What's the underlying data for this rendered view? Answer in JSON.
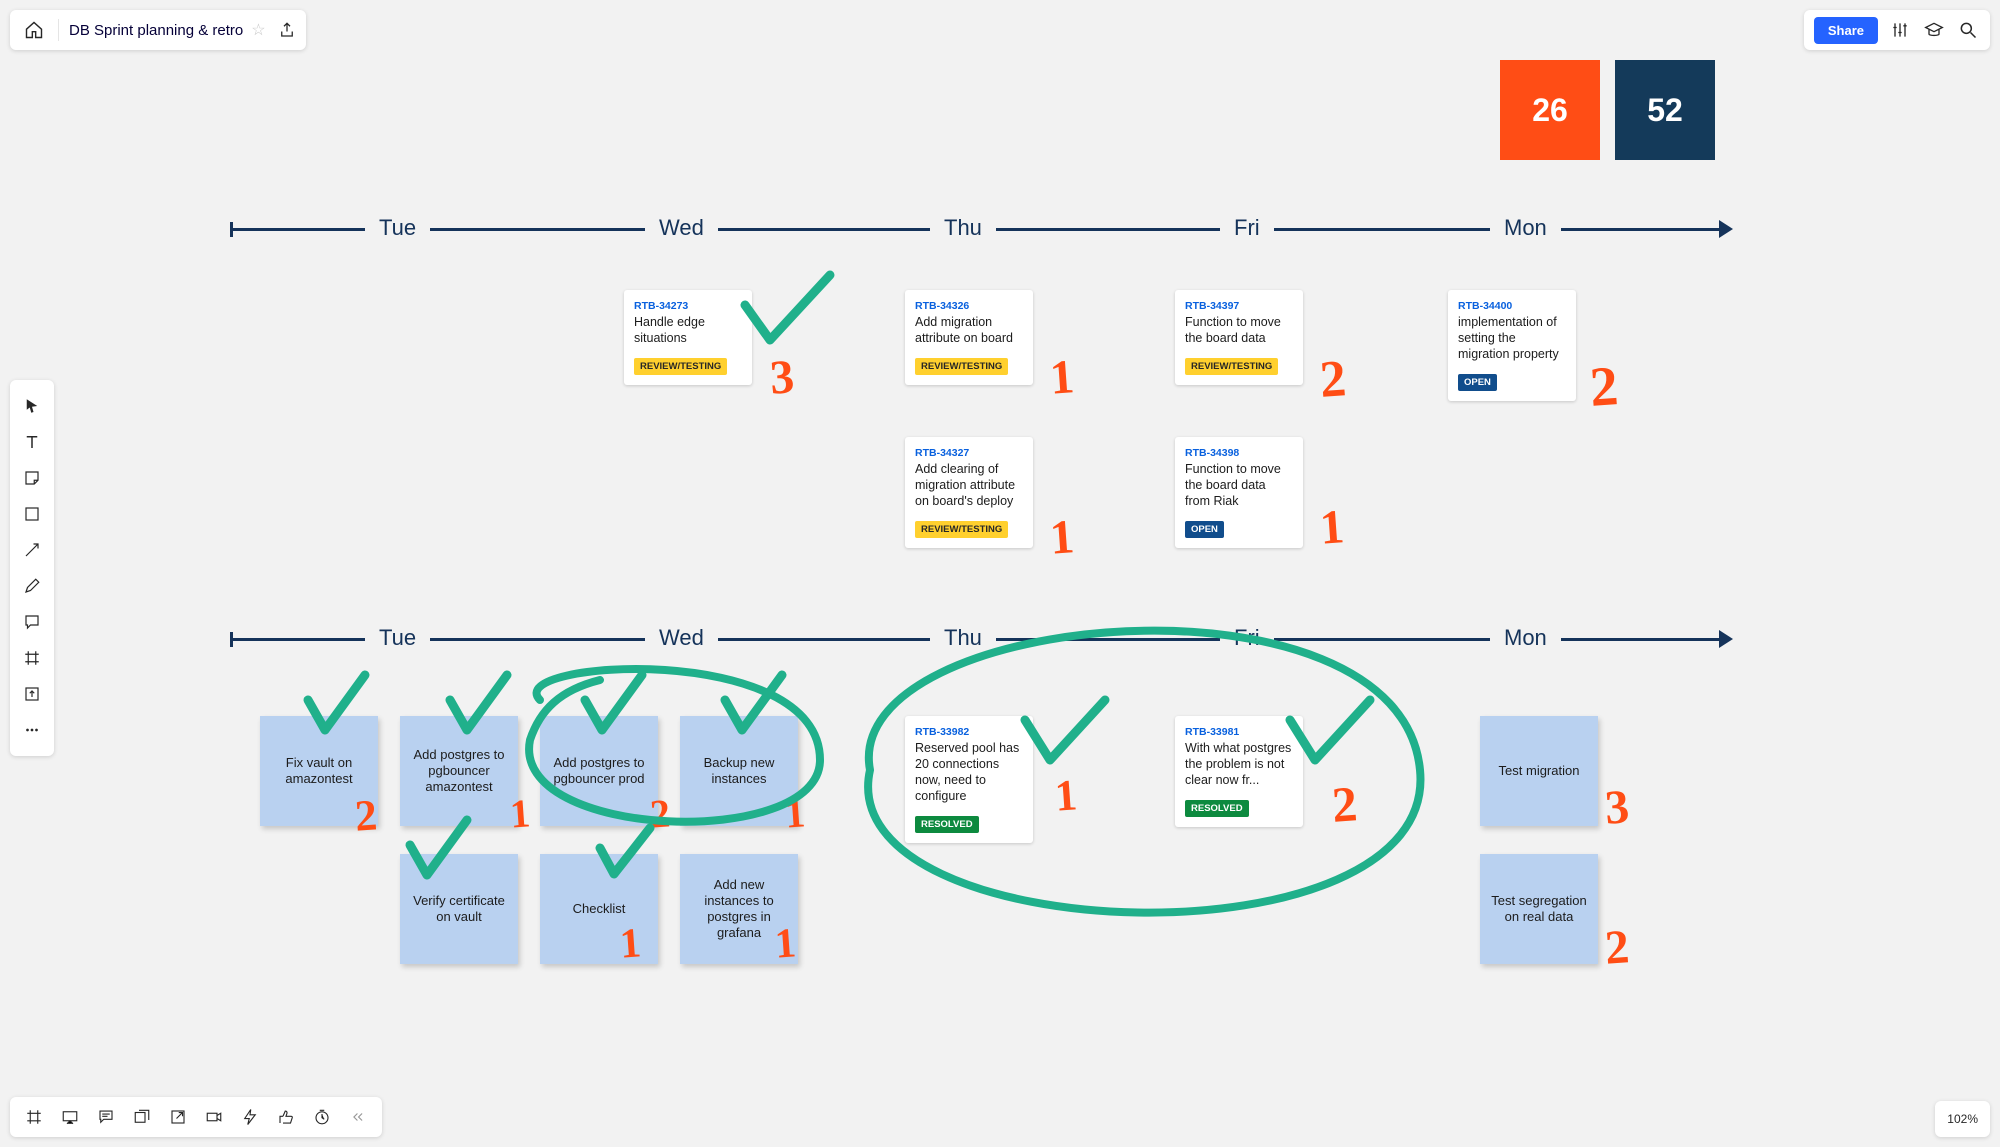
{
  "header": {
    "title": "DB Sprint planning & retro",
    "share_label": "Share"
  },
  "scores": {
    "orange": "26",
    "navy": "52"
  },
  "timeline_labels": [
    "Tue",
    "Wed",
    "Thu",
    "Fri",
    "Mon"
  ],
  "row1_cards": [
    {
      "id": "RTB-34273",
      "title": "Handle edge situations",
      "badge": "REVIEW/TESTING",
      "badge_cls": "b-review",
      "anno": "3",
      "check": true
    },
    {
      "id": "RTB-34326",
      "title": "Add migration attribute on board",
      "badge": "REVIEW/TESTING",
      "badge_cls": "b-review",
      "anno": "1"
    },
    {
      "id": "RTB-34397",
      "title": "Function to move the board data",
      "badge": "REVIEW/TESTING",
      "badge_cls": "b-review",
      "anno": "2"
    },
    {
      "id": "RTB-34400",
      "title": "implementation of setting the migration property",
      "badge": "OPEN",
      "badge_cls": "b-open",
      "anno": "2"
    },
    {
      "id": "RTB-34327",
      "title": "Add clearing of migration attribute on board's deploy",
      "badge": "REVIEW/TESTING",
      "badge_cls": "b-review",
      "anno": "1"
    },
    {
      "id": "RTB-34398",
      "title": "Function to move the board data from Riak",
      "badge": "OPEN",
      "badge_cls": "b-open",
      "anno": "1"
    }
  ],
  "row2_stickies": [
    {
      "text": "Fix vault on amazontest",
      "anno": "2",
      "check": true
    },
    {
      "text": "Add postgres to pgbouncer amazontest",
      "anno": "1",
      "check": true
    },
    {
      "text": "Add postgres to pgbouncer prod",
      "anno": "2",
      "check": true
    },
    {
      "text": "Backup new instances",
      "anno": "1",
      "check": true
    },
    {
      "text": "Verify certificate on vault",
      "anno": "",
      "check": true
    },
    {
      "text": "Checklist",
      "anno": "1",
      "check": true
    },
    {
      "text": "Add new instances to postgres in grafana",
      "anno": "1"
    },
    {
      "text": "Test migration",
      "anno": "3"
    },
    {
      "text": "Test segregation on real data",
      "anno": "2"
    }
  ],
  "row2_cards": [
    {
      "id": "RTB-33982",
      "title": "Reserved pool has 20 connections now, need to configure",
      "badge": "RESOLVED",
      "badge_cls": "b-res",
      "anno": "1",
      "check": true
    },
    {
      "id": "RTB-33981",
      "title": "With what postgres the problem is not clear now fr...",
      "badge": "RESOLVED",
      "badge_cls": "b-res",
      "anno": "2",
      "check": true
    }
  ],
  "zoom": "102%"
}
